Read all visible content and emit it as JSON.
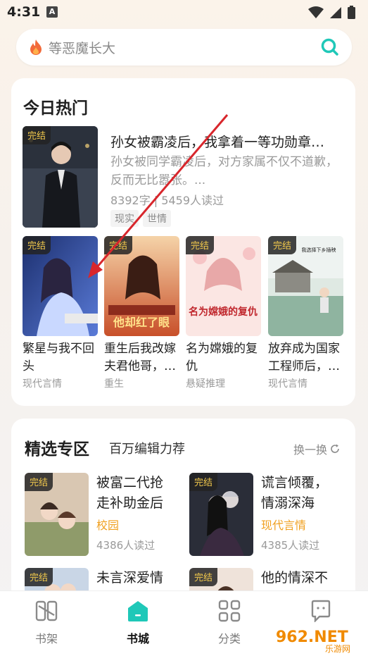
{
  "status": {
    "time": "4:31",
    "a_icon": "A"
  },
  "search": {
    "placeholder": "等恶魔长大"
  },
  "hot": {
    "title": "今日热门",
    "featured": {
      "badge": "完结",
      "title": "孙女被霸凌后，我拿着一等功勋章…",
      "desc": "孙女被同学霸凌后，对方家属不仅不道歉，反而无比嚣张。...",
      "meta": "8392字 | 5459人读过",
      "tags": [
        "现实",
        "世情"
      ]
    },
    "grid": [
      {
        "badge": "完结",
        "title": "繁星与我不回头",
        "category": "现代言情",
        "cover_text": ""
      },
      {
        "badge": "完结",
        "title": "重生后我改嫁夫君他哥，…",
        "category": "重生",
        "cover_text": "他却红了眼"
      },
      {
        "badge": "完结",
        "title": "名为嫦娥的复仇",
        "category": "悬疑推理",
        "cover_text": "名为嫦娥的复仇"
      },
      {
        "badge": "完结",
        "title": "放弃成为国家工程师后，…",
        "category": "现代言情",
        "cover_text": "我选择下乡插秧"
      }
    ]
  },
  "selected": {
    "title": "精选专区",
    "subtitle": "百万编辑力荐",
    "refresh": "换一换",
    "items": [
      {
        "badge": "完结",
        "title": "被富二代抢走补助金后",
        "category": "校园",
        "reads": "4386人读过"
      },
      {
        "badge": "完结",
        "title": "谎言倾覆，情溺深海",
        "category": "现代言情",
        "reads": "4385人读过"
      },
      {
        "badge": "完结",
        "title": "未言深爱情",
        "category": "",
        "reads": ""
      },
      {
        "badge": "完结",
        "title": "他的情深不",
        "category": "",
        "reads": ""
      }
    ]
  },
  "nav": {
    "items": [
      {
        "label": "书架",
        "icon": "bookshelf-icon"
      },
      {
        "label": "书城",
        "icon": "home-icon"
      },
      {
        "label": "分类",
        "icon": "category-icon"
      },
      {
        "label": "",
        "icon": "profile-icon"
      }
    ]
  },
  "watermark": {
    "text": "962.NET",
    "sub": "乐游网"
  },
  "colors": {
    "accent": "#1fc8b8",
    "badge_text": "#f2c94c",
    "category_highlight": "#f0a020",
    "arrow": "#d8262c"
  }
}
